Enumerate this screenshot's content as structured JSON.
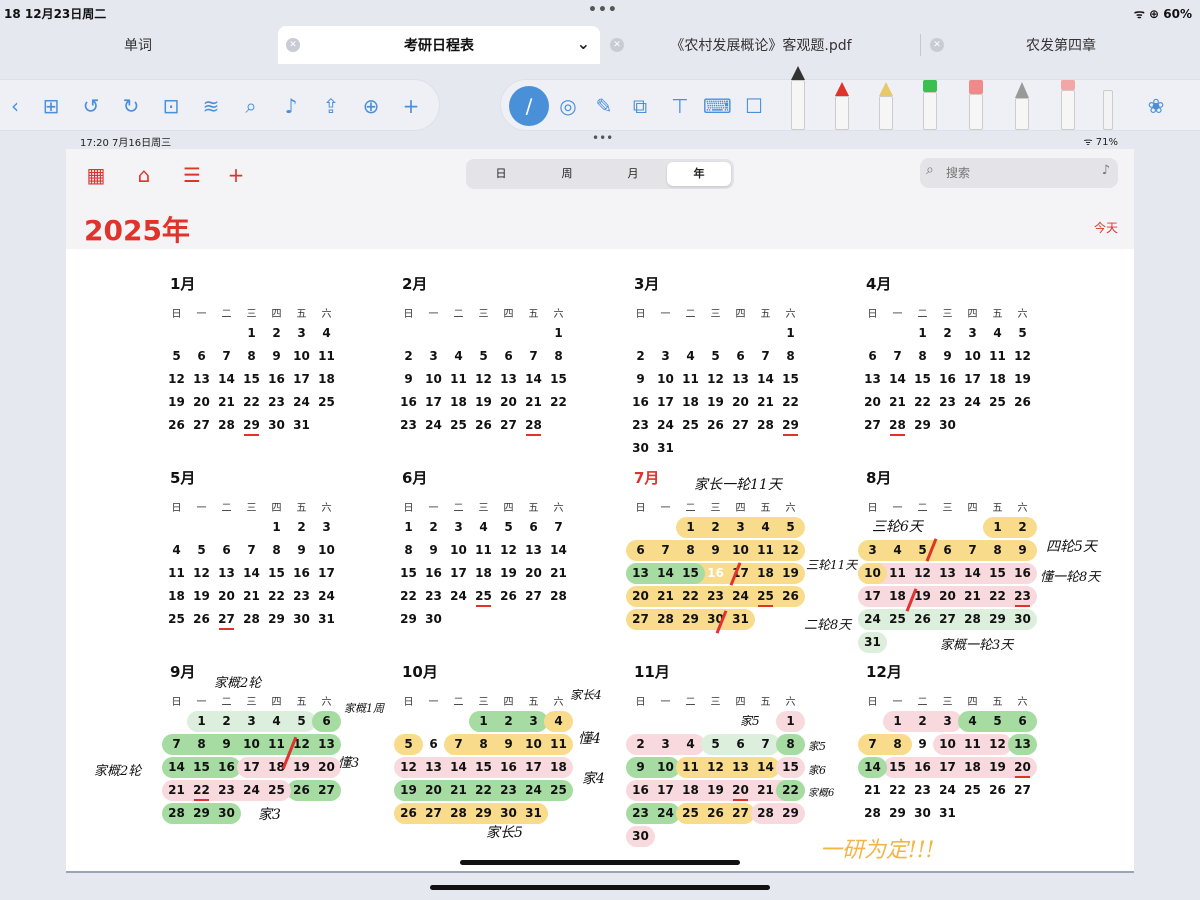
{
  "status": {
    "left": "18  12月23日周二",
    "right": "ᯤ ⊕ 60%"
  },
  "tabs": [
    {
      "label": "单词"
    },
    {
      "label": "考研日程表"
    },
    {
      "label": "《农村发展概论》客观题.pdf"
    },
    {
      "label": "农发第四章"
    }
  ],
  "inner_status": {
    "left": "17:20  7月16日周三",
    "right": "ᯤ 71%"
  },
  "view_switch": {
    "day": "日",
    "week": "周",
    "month": "月",
    "year": "年"
  },
  "search": {
    "placeholder": "搜索"
  },
  "year_title": "2025年",
  "today_label": "今天",
  "weekdays": [
    "日",
    "一",
    "二",
    "三",
    "四",
    "五",
    "六"
  ],
  "months": [
    {
      "name": "1月",
      "first": 3,
      "days": 31,
      "underline": [
        29
      ]
    },
    {
      "name": "2月",
      "first": 6,
      "days": 28,
      "underline": [
        28
      ]
    },
    {
      "name": "3月",
      "first": 6,
      "days": 31,
      "underline": [
        29
      ]
    },
    {
      "name": "4月",
      "first": 2,
      "days": 30,
      "underline": [
        28
      ]
    },
    {
      "name": "5月",
      "first": 4,
      "days": 31,
      "underline": [
        27
      ]
    },
    {
      "name": "6月",
      "first": 0,
      "days": 30,
      "underline": [
        25
      ]
    },
    {
      "name": "7月",
      "first": 2,
      "days": 31,
      "underline": [
        25
      ],
      "current": true,
      "today": 16
    },
    {
      "name": "8月",
      "first": 5,
      "days": 31,
      "underline": [
        23
      ]
    },
    {
      "name": "9月",
      "first": 1,
      "days": 30,
      "underline": [
        22
      ]
    },
    {
      "name": "10月",
      "first": 3,
      "days": 31,
      "underline": []
    },
    {
      "name": "11月",
      "first": 6,
      "days": 30,
      "underline": [
        20
      ]
    },
    {
      "name": "12月",
      "first": 1,
      "days": 31,
      "underline": [
        20
      ]
    }
  ],
  "highlights": [
    {
      "m": 6,
      "c": "y",
      "ranges": [
        [
          1,
          5
        ],
        [
          6,
          12
        ],
        [
          13,
          19
        ],
        [
          20,
          26
        ],
        [
          27,
          31
        ]
      ]
    },
    {
      "m": 6,
      "c": "g",
      "ranges": [
        [
          13,
          15
        ]
      ]
    },
    {
      "m": 7,
      "c": "y",
      "ranges": [
        [
          1,
          2
        ],
        [
          3,
          9
        ]
      ]
    },
    {
      "m": 7,
      "c": "p",
      "ranges": [
        [
          10,
          16
        ],
        [
          17,
          23
        ]
      ]
    },
    {
      "m": 7,
      "c": "y",
      "ranges": [
        [
          10,
          10
        ]
      ]
    },
    {
      "m": 7,
      "c": "lg",
      "ranges": [
        [
          24,
          30
        ],
        [
          31,
          31
        ]
      ]
    },
    {
      "m": 8,
      "c": "lg",
      "ranges": [
        [
          1,
          5
        ]
      ]
    },
    {
      "m": 8,
      "c": "g",
      "ranges": [
        [
          6,
          6
        ],
        [
          7,
          13
        ],
        [
          14,
          16
        ],
        [
          26,
          27
        ],
        [
          28,
          30
        ]
      ]
    },
    {
      "m": 8,
      "c": "p",
      "ranges": [
        [
          17,
          20
        ],
        [
          21,
          25
        ]
      ]
    },
    {
      "m": 9,
      "c": "g",
      "ranges": [
        [
          1,
          3
        ]
      ]
    },
    {
      "m": 9,
      "c": "y",
      "ranges": [
        [
          4,
          4
        ],
        [
          5,
          5
        ],
        [
          7,
          11
        ],
        [
          26,
          31
        ]
      ]
    },
    {
      "m": 9,
      "c": "p",
      "ranges": [
        [
          12,
          18
        ]
      ]
    },
    {
      "m": 9,
      "c": "g",
      "ranges": [
        [
          19,
          25
        ]
      ]
    },
    {
      "m": 10,
      "c": "p",
      "ranges": [
        [
          1,
          1
        ],
        [
          2,
          4
        ],
        [
          16,
          22
        ],
        [
          30,
          30
        ]
      ]
    },
    {
      "m": 10,
      "c": "lg",
      "ranges": [
        [
          5,
          7
        ]
      ]
    },
    {
      "m": 10,
      "c": "g",
      "ranges": [
        [
          8,
          8
        ],
        [
          9,
          10
        ],
        [
          22,
          22
        ],
        [
          23,
          24
        ]
      ]
    },
    {
      "m": 10,
      "c": "y",
      "ranges": [
        [
          11,
          14
        ],
        [
          25,
          27
        ]
      ]
    },
    {
      "m": 10,
      "c": "p",
      "ranges": [
        [
          15,
          15
        ],
        [
          28,
          29
        ]
      ]
    },
    {
      "m": 11,
      "c": "p",
      "ranges": [
        [
          1,
          3
        ],
        [
          10,
          12
        ],
        [
          15,
          20
        ]
      ]
    },
    {
      "m": 11,
      "c": "g",
      "ranges": [
        [
          4,
          6
        ],
        [
          13,
          13
        ],
        [
          14,
          14
        ]
      ]
    },
    {
      "m": 11,
      "c": "y",
      "ranges": [
        [
          7,
          8
        ]
      ]
    }
  ],
  "notes": [
    {
      "text": "家长一轮11天"
    },
    {
      "text": "三轮11天"
    },
    {
      "text": "二轮8天"
    },
    {
      "text": "三轮6天"
    },
    {
      "text": "四轮5天"
    },
    {
      "text": "懂一轮8天"
    },
    {
      "text": "家概一轮3天"
    },
    {
      "text": "家概2轮"
    },
    {
      "text": "家概1周"
    },
    {
      "text": "懂3"
    },
    {
      "text": "家概2轮"
    },
    {
      "text": "家3"
    },
    {
      "text": "家长4"
    },
    {
      "text": "懂4"
    },
    {
      "text": "家4"
    },
    {
      "text": "家长5"
    },
    {
      "text": "家5"
    },
    {
      "text": "家5"
    },
    {
      "text": "家6"
    },
    {
      "text": "家概6"
    },
    {
      "text": "一研为定!!!"
    }
  ]
}
